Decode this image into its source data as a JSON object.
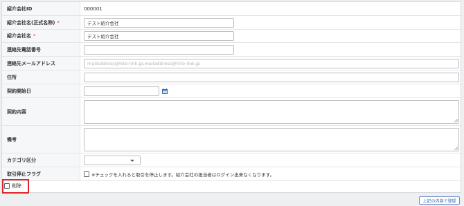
{
  "form": {
    "rows": [
      {
        "label": "紹介会社ID",
        "required": false,
        "value": "000001"
      },
      {
        "label": "紹介会社名(正式名称)",
        "required": true,
        "value": "テスト紹介会社"
      },
      {
        "label": "紹介会社名",
        "required": true,
        "value": "テスト紹介会社"
      },
      {
        "label": "連絡先電話番号",
        "required": false,
        "value": ""
      },
      {
        "label": "連絡先メールアドレス",
        "required": false,
        "placeholder": "mailaddress@hito-link.jp;mailaddress@hito-link.jp"
      },
      {
        "label": "住所",
        "required": false,
        "value": ""
      },
      {
        "label": "契約開始日",
        "required": false,
        "value": ""
      },
      {
        "label": "契約内容",
        "required": false,
        "value": ""
      },
      {
        "label": "備考",
        "required": false,
        "value": ""
      },
      {
        "label": "カテゴリ区分",
        "required": false,
        "value": ""
      },
      {
        "label": "取引停止フラグ",
        "required": false,
        "checkbox_text": "※チェックを入れると取引を停止します。紹介会社の担当者はログイン出来なくなります。"
      }
    ],
    "required_mark": "*"
  },
  "delete": {
    "label": "削除"
  },
  "submit": {
    "label": "上記の内容で登録"
  },
  "colors": {
    "required": "#e0393e",
    "highlight": "#e0242b",
    "calendar_icon": "#2f6fb5",
    "button_text": "#3b6bb0"
  },
  "icons": {
    "calendar": "calendar-icon",
    "dropdown": "chevron-down-icon"
  }
}
